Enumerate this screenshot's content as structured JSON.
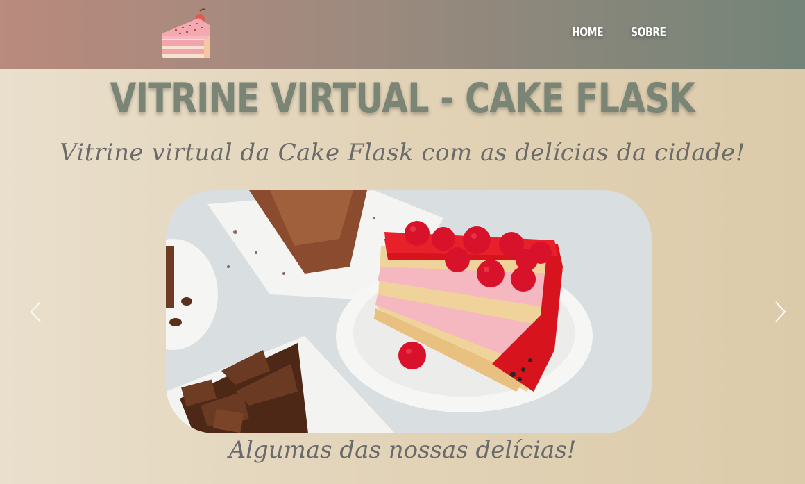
{
  "header": {
    "logo_icon": "cake-slice-icon",
    "nav": [
      {
        "label": "Home"
      },
      {
        "label": "Sobre"
      }
    ]
  },
  "main": {
    "title": "Vitrine Virtual - Cake Flask",
    "subtitle": "Vitrine virtual da Cake Flask com as delícias da cidade!",
    "carousel": {
      "image_icon": "cake-photo",
      "prev_icon": "chevron-left-icon",
      "next_icon": "chevron-right-icon"
    },
    "caption": "Algumas das nossas delícias!"
  },
  "colors": {
    "header_left": "#b98a7d",
    "header_right": "#748478",
    "title": "#7a8575",
    "script_text": "#6a6a6a"
  }
}
